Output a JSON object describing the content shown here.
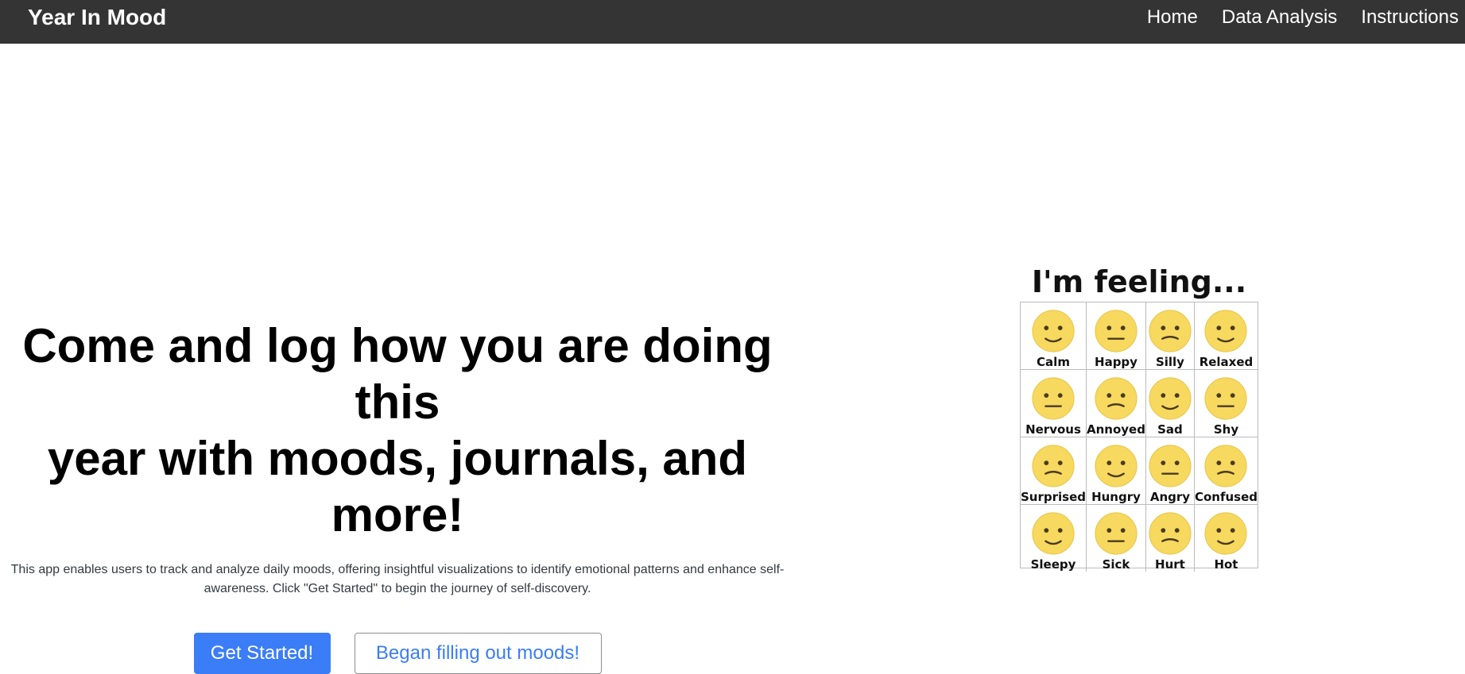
{
  "navbar": {
    "brand": "Year In Mood",
    "links": [
      "Home",
      "Data Analysis",
      "Instructions"
    ]
  },
  "hero": {
    "headline_line1": "Come and log how you are doing this",
    "headline_line2": "year with moods, journals, and more!",
    "description_line1": "This app enables users to track and analyze daily moods, offering insightful visualizations to identify emotional patterns and enhance self-",
    "description_line2": "awareness. Click \"Get Started\" to begin the journey of self-discovery.",
    "primary_button": "Get Started!",
    "secondary_button": "Began filling out moods!"
  },
  "mood_chart": {
    "title": "I'm feeling...",
    "moods": [
      "Calm",
      "Happy",
      "Silly",
      "Relaxed",
      "Nervous",
      "Annoyed",
      "Sad",
      "Shy",
      "Surprised",
      "Hungry",
      "Angry",
      "Confused",
      "Sleepy",
      "Sick",
      "Hurt",
      "Hot"
    ]
  },
  "colors": {
    "navbar": "#343434",
    "primary": "#3b7df6",
    "face": "#f6d95e"
  }
}
